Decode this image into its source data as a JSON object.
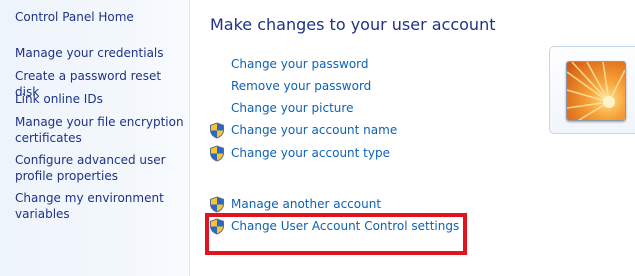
{
  "sidebar": {
    "home": "Control Panel Home",
    "links": [
      "Manage your credentials",
      "Create a password reset disk",
      "Link online IDs",
      "Manage your file encryption certificates",
      "Configure advanced user profile properties",
      "Change my environment variables"
    ]
  },
  "main": {
    "title": "Make changes to your user account",
    "tasks": [
      {
        "label": "Change your password",
        "icon": "none"
      },
      {
        "label": "Remove your password",
        "icon": "none"
      },
      {
        "label": "Change your picture",
        "icon": "none"
      },
      {
        "label": "Change your account name",
        "icon": "uac-shield-icon"
      },
      {
        "label": "Change your account type",
        "icon": "uac-shield-icon"
      }
    ],
    "other_tasks": [
      {
        "label": "Manage another account",
        "icon": "uac-shield-icon"
      },
      {
        "label": "Change User Account Control settings",
        "icon": "uac-shield-icon"
      }
    ]
  },
  "colors": {
    "sidebar_link": "#1e3287",
    "task_link": "#0d62b6",
    "title": "#1e3287",
    "highlight": "#e0141e"
  }
}
